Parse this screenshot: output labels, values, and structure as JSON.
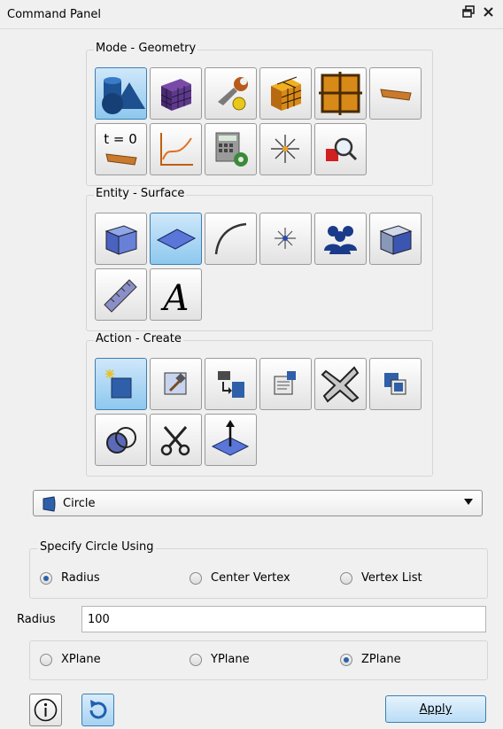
{
  "panel": {
    "title": "Command Panel",
    "float_icon": "float-icon",
    "close_icon": "close-icon"
  },
  "mode_group": {
    "label": "Mode - Geometry",
    "buttons": [
      {
        "icon": "geometry-mode-icon",
        "active": true
      },
      {
        "icon": "mesh-mode-icon",
        "active": false
      },
      {
        "icon": "tools-mode-icon",
        "active": false
      },
      {
        "icon": "hex-mesh-icon",
        "active": false
      },
      {
        "icon": "grid-mesh-icon",
        "active": false
      },
      {
        "icon": "material-icon",
        "active": false
      },
      {
        "icon": "time-zero-icon",
        "active": false,
        "text": "t = 0"
      },
      {
        "icon": "graph-curve-icon",
        "active": false
      },
      {
        "icon": "calculator-settings-icon",
        "active": false
      },
      {
        "icon": "spark-vertex-icon",
        "active": false
      },
      {
        "icon": "magnify-box-icon",
        "active": false
      }
    ]
  },
  "entity_group": {
    "label": "Entity - Surface",
    "buttons": [
      {
        "icon": "volume-cube-icon",
        "active": false
      },
      {
        "icon": "surface-icon",
        "active": true
      },
      {
        "icon": "curve-icon",
        "active": false
      },
      {
        "icon": "vertex-icon",
        "active": false
      },
      {
        "icon": "group-people-icon",
        "active": false
      },
      {
        "icon": "body-cube-icon",
        "active": false
      },
      {
        "icon": "ruler-icon",
        "active": false
      },
      {
        "icon": "text-a-icon",
        "active": false,
        "text": "A"
      }
    ]
  },
  "action_group": {
    "label": "Action - Create",
    "buttons": [
      {
        "icon": "create-new-icon",
        "active": true
      },
      {
        "icon": "modify-hammer-icon",
        "active": false
      },
      {
        "icon": "transform-move-icon",
        "active": false
      },
      {
        "icon": "properties-icon",
        "active": false
      },
      {
        "icon": "delete-x-icon",
        "active": false
      },
      {
        "icon": "copy-icon",
        "active": false
      },
      {
        "icon": "boolean-icon",
        "active": false
      },
      {
        "icon": "scissors-icon",
        "active": false
      },
      {
        "icon": "normal-arrow-icon",
        "active": false
      }
    ]
  },
  "shape_select": {
    "value": "Circle",
    "icon": "circle-surface-icon"
  },
  "specify": {
    "label": "Specify Circle Using",
    "options": [
      {
        "label": "Radius",
        "checked": true
      },
      {
        "label": "Center Vertex",
        "checked": false
      },
      {
        "label": "Vertex List",
        "checked": false
      }
    ]
  },
  "radius": {
    "label": "Radius",
    "value": "100"
  },
  "plane": {
    "options": [
      {
        "label": "XPlane",
        "checked": false
      },
      {
        "label": "YPlane",
        "checked": false
      },
      {
        "label": "ZPlane",
        "checked": true
      }
    ]
  },
  "footer": {
    "info_icon": "info-icon",
    "reset_icon": "reset-icon",
    "apply_label": "Apply"
  },
  "colors": {
    "active_button": "#8ec8ee",
    "accent": "#3c7fb1",
    "panel_bg": "#f0f0f0"
  }
}
